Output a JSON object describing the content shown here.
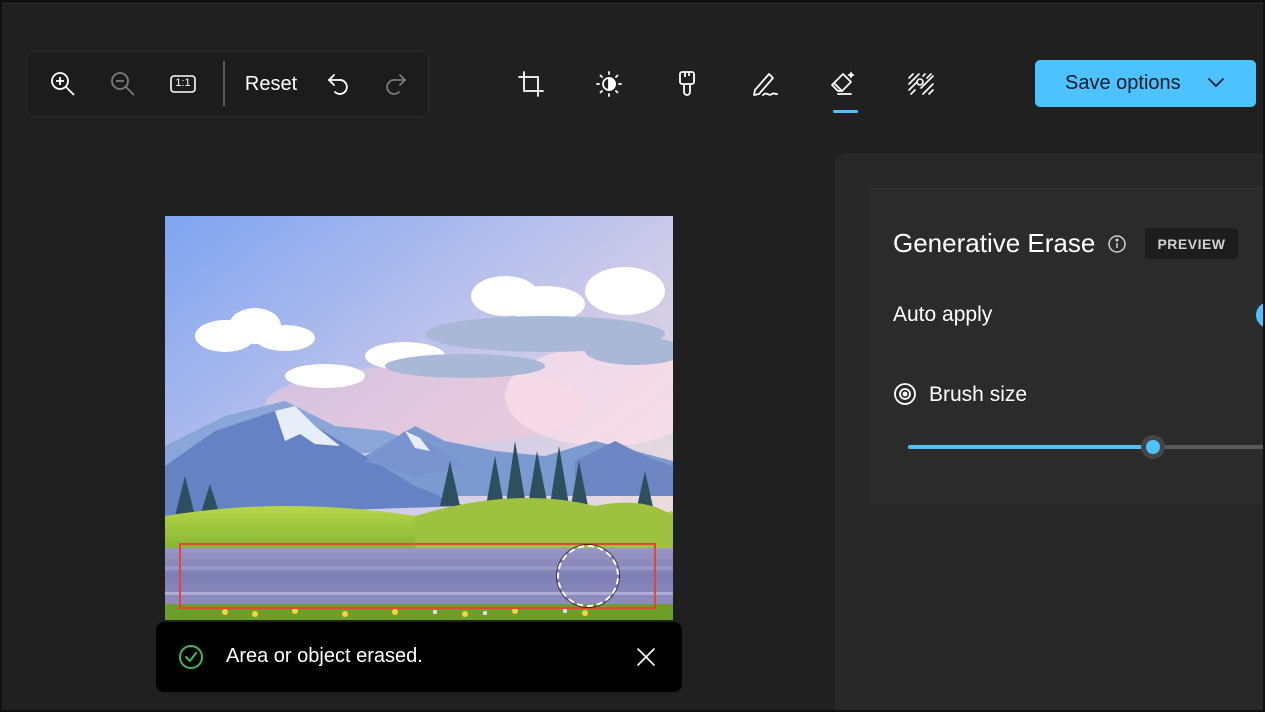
{
  "toolbar": {
    "reset_label": "Reset",
    "zoom_in_icon": "zoom-in-icon",
    "zoom_out_icon": "zoom-out-icon",
    "actual_size_label": "1:1",
    "undo_icon": "undo-icon",
    "redo_icon": "redo-icon"
  },
  "tools": [
    {
      "name": "crop",
      "icon": "crop-icon"
    },
    {
      "name": "adjust",
      "icon": "brightness-icon"
    },
    {
      "name": "filter",
      "icon": "brush-filter-icon"
    },
    {
      "name": "markup",
      "icon": "pen-icon"
    },
    {
      "name": "erase",
      "icon": "eraser-icon",
      "active": true
    },
    {
      "name": "background",
      "icon": "background-icon"
    }
  ],
  "save": {
    "label": "Save options"
  },
  "panel": {
    "title": "Generative Erase",
    "badge": "PREVIEW",
    "auto_apply_label": "Auto apply",
    "auto_apply_on": true,
    "brush_size_label": "Brush size",
    "brush_size_fraction": 0.68
  },
  "toast": {
    "message": "Area or object erased."
  },
  "colors": {
    "accent": "#4cc2ff",
    "background": "#202020",
    "selection": "#e8433b",
    "success": "#3fb950"
  }
}
